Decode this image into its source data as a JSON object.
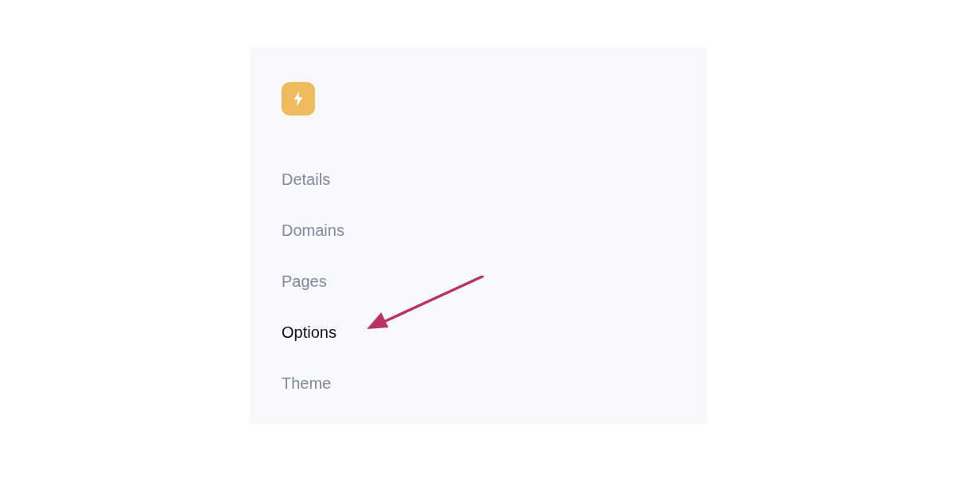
{
  "sidebar": {
    "items": [
      {
        "label": "Details",
        "selected": false
      },
      {
        "label": "Domains",
        "selected": false
      },
      {
        "label": "Pages",
        "selected": false
      },
      {
        "label": "Options",
        "selected": true
      },
      {
        "label": "Theme",
        "selected": false
      }
    ]
  }
}
